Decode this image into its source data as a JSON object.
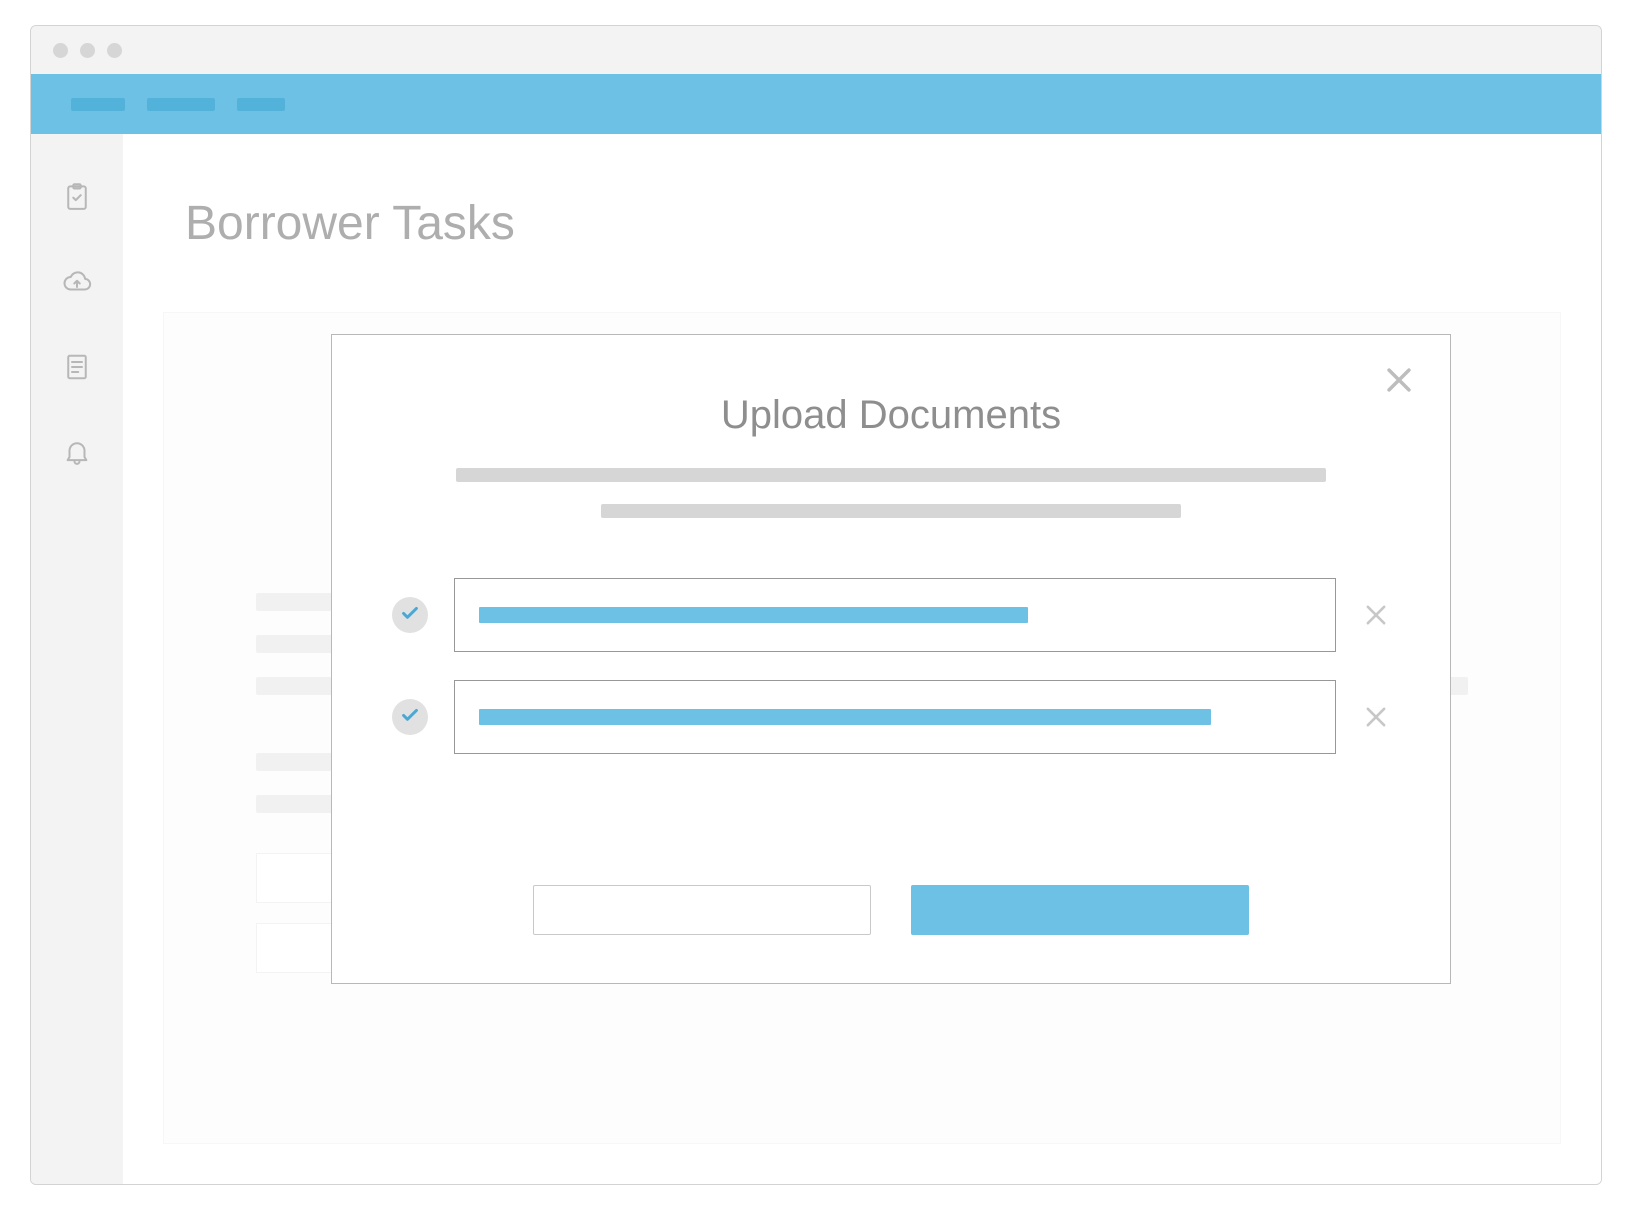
{
  "page": {
    "title": "Borrower Tasks"
  },
  "sidebar": {
    "items": [
      {
        "name": "clipboard-icon"
      },
      {
        "name": "cloud-upload-icon"
      },
      {
        "name": "document-icon"
      },
      {
        "name": "bell-icon"
      }
    ]
  },
  "modal": {
    "title": "Upload Documents",
    "uploads": [
      {
        "status": "complete",
        "progress_percent": 66
      },
      {
        "status": "complete",
        "progress_percent": 88
      }
    ],
    "actions": {
      "secondary_label": "",
      "primary_label": ""
    }
  },
  "colors": {
    "accent": "#6dc1e5",
    "accent_dark": "#4aa8d4",
    "muted_text": "#8e8e8e"
  }
}
